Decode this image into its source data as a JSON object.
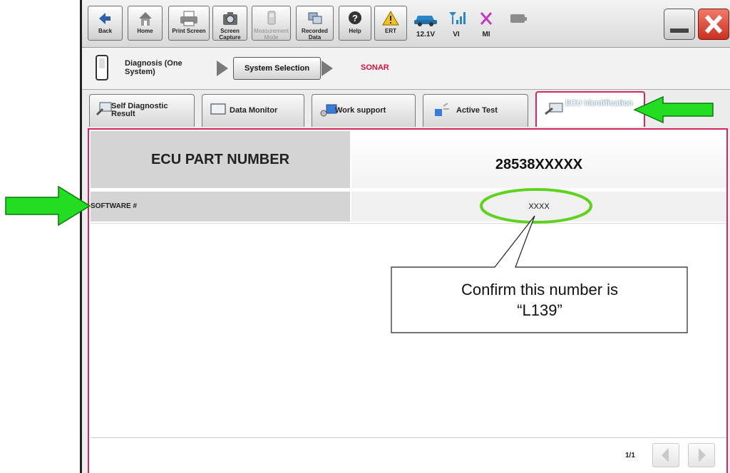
{
  "toolbar": {
    "back": "Back",
    "home": "Home",
    "print_screen": "Print Screen",
    "screen_capture": "Screen Capture",
    "measurement_mode": "Measurement Mode",
    "recorded_data": "Recorded Data",
    "help": "Help",
    "ert": "ERT",
    "voltage": "12.1V",
    "vi": "VI",
    "mi": "MI"
  },
  "breadcrumb": {
    "diagnosis": "Diagnosis (One System)",
    "system_selection": "System Selection",
    "current": "SONAR"
  },
  "tabs": [
    {
      "label": "Self Diagnostic Result"
    },
    {
      "label": "Data Monitor"
    },
    {
      "label": "Work support"
    },
    {
      "label": "Active Test"
    },
    {
      "label": "ECU Identification"
    }
  ],
  "ecu": {
    "part_number_label": "ECU PART NUMBER",
    "part_number_value": "28538XXXXX",
    "software_label": "SOFTWARE #",
    "software_value": "XXXX"
  },
  "pager": {
    "text": "1/1"
  },
  "callout": {
    "line1": "Confirm this number is",
    "line2": "“L139”"
  },
  "colors": {
    "active_tab_border": "#d2285a",
    "breadcrumb_current": "#d2143a",
    "annotation_arrow": "#22dd22",
    "highlight_ellipse": "#5fd21e"
  }
}
